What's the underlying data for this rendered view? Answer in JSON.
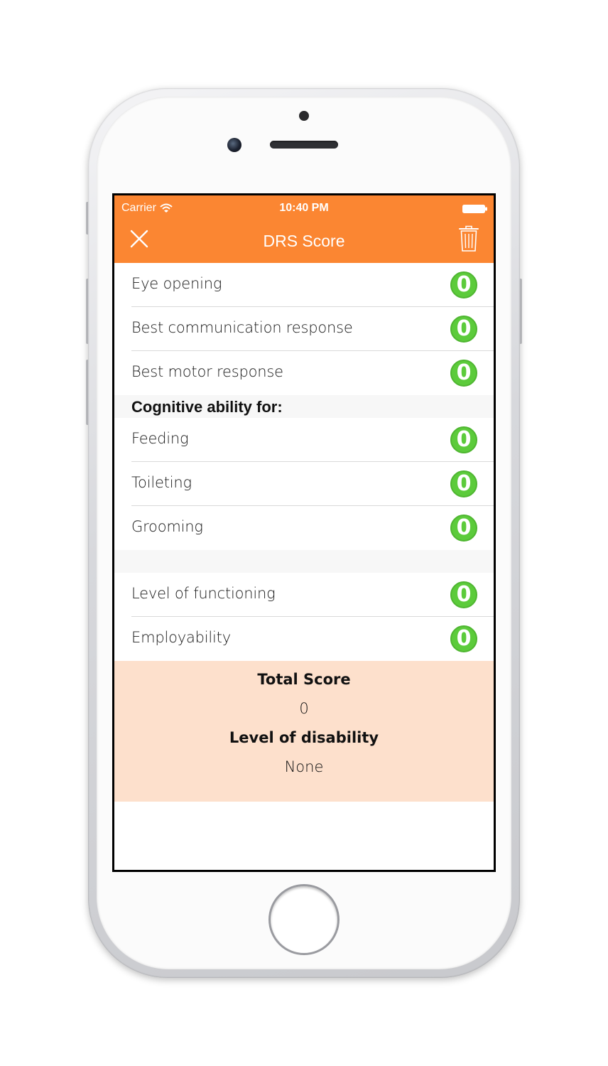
{
  "status_bar": {
    "carrier": "Carrier",
    "time": "10:40 PM"
  },
  "nav": {
    "title": "DRS Score",
    "left_icon": "close-icon",
    "right_icon": "trash-icon"
  },
  "group_1": [
    {
      "label": "Eye opening",
      "score": "0"
    },
    {
      "label": "Best communication response",
      "score": "0"
    },
    {
      "label": "Best motor response",
      "score": "0"
    }
  ],
  "cognitive_header": "Cognitive ability for:",
  "group_2": [
    {
      "label": "Feeding",
      "score": "0"
    },
    {
      "label": "Toileting",
      "score": "0"
    },
    {
      "label": "Grooming",
      "score": "0"
    }
  ],
  "group_3": [
    {
      "label": "Level of functioning",
      "score": "0"
    },
    {
      "label": "Employability",
      "score": "0"
    }
  ],
  "summary": {
    "total_label": "Total Score",
    "total_value": "0",
    "disability_label": "Level of disability",
    "disability_value": "None"
  },
  "colors": {
    "accent": "#fb8632",
    "badge": "#5ccb3b",
    "summary_bg": "#fde0cc"
  }
}
